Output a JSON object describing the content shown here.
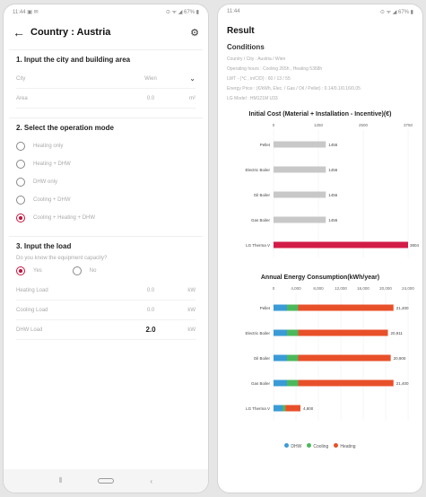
{
  "left": {
    "status_time": "11:44 ▣ ✉",
    "status_icons": "⊙ ᯤ ◢ 67% ▮",
    "title": "Country : Austria",
    "section1": {
      "title": "1. Input the city and building area",
      "city_label": "City",
      "city_value": "Wien",
      "area_label": "Area",
      "area_value": "0.0",
      "area_unit": "m²"
    },
    "section2": {
      "title": "2. Select the operation mode",
      "options": [
        "Heating only",
        "Heating + DHW",
        "DHW only",
        "Cooling + DHW",
        "Cooling + Heating + DHW"
      ],
      "selected_index": 4
    },
    "section3": {
      "title": "3. Input the load",
      "question": "Do you know the equipment capacity?",
      "yes": "Yes",
      "no": "No",
      "heating_label": "Heating Load",
      "heating_value": "0.0",
      "heating_unit": "kW",
      "cooling_label": "Cooling Load",
      "cooling_value": "0.0",
      "cooling_unit": "kW",
      "dhw_label": "DHW Load",
      "dhw_value": "2.0",
      "dhw_unit": "kW"
    }
  },
  "right": {
    "status_time": "11:44",
    "status_icons": "⊙ ᯤ ◢ 67% ▮",
    "title": "Result",
    "conditions_title": "Conditions",
    "conditions": [
      {
        "label": "Country / City :",
        "value": "Austria / Wien"
      },
      {
        "label": "Operating hours :",
        "value": "Cooling 265h , Heating 5368h"
      },
      {
        "label": "LWT - (℃ , in/C/D) :",
        "value": "60 / 13 / 55"
      },
      {
        "label": "Energy Price :",
        "value": "(€/kWh, Elec. / Gas / Oil / Pellet) : 0.14/0.1/0.16/0.05"
      },
      {
        "label": "LG Model :",
        "value": "HM121M U33"
      }
    ]
  },
  "chart_data": [
    {
      "type": "bar",
      "title": "Initial Cost (Material + Installation - Incentive)(€)",
      "categories": [
        "Pellet",
        "Electric Boiler",
        "Oil Boiler",
        "Gas Boiler",
        "LG Therma V"
      ],
      "values": [
        1456,
        1456,
        1456,
        1456,
        3804
      ],
      "xlim": [
        0,
        3750
      ],
      "ticks": [
        "0",
        "1250",
        "2500",
        "3750"
      ],
      "data_labels": [
        "1456",
        "1456",
        "1456",
        "1456",
        "3804"
      ],
      "colors": [
        "#c8c8c8",
        "#c8c8c8",
        "#c8c8c8",
        "#c8c8c8",
        "#d21c47"
      ]
    },
    {
      "type": "bar",
      "title": "Annual Energy Consumption(kWh/year)",
      "categories": [
        "Pellet",
        "Electric Boiler",
        "Oil Boiler",
        "Gas Boiler",
        "LG Therma V"
      ],
      "series": [
        {
          "name": "DHW",
          "values": [
            2400,
            2400,
            2400,
            2400,
            1600
          ],
          "color": "#3a9bd6"
        },
        {
          "name": "Cooling",
          "values": [
            2000,
            2000,
            2000,
            2000,
            500
          ],
          "color": "#4cb85c"
        },
        {
          "name": "Heating",
          "values": [
            17000,
            16000,
            16500,
            17000,
            2700
          ],
          "color": "#e8502a"
        }
      ],
      "xlim": [
        0,
        24000
      ],
      "ticks": [
        "0",
        "4,000",
        "8,000",
        "12,000",
        "16,000",
        "20,000",
        "24,000"
      ],
      "data_labels": [
        "21,400",
        "20,911",
        "20,900",
        "21,400",
        "4,800"
      ]
    }
  ],
  "colors": {
    "accent": "#c4163f"
  }
}
